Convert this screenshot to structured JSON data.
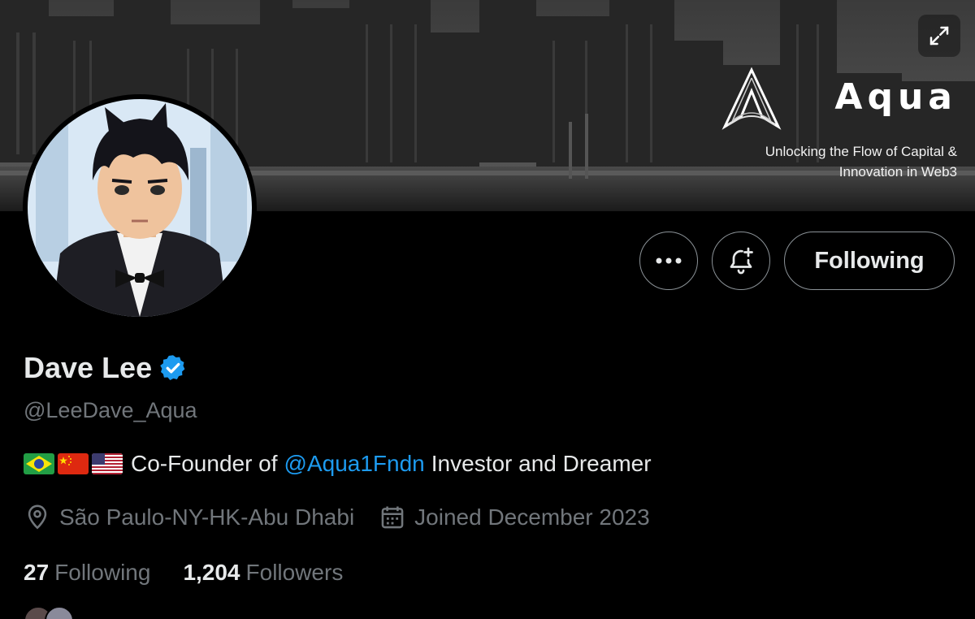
{
  "banner": {
    "brand_name": "Aqua",
    "brand_tagline_line1": "Unlocking the Flow of Capital &",
    "brand_tagline_line2": "Innovation in Web3",
    "expand_icon": "expand-icon"
  },
  "profile": {
    "display_name": "Dave Lee",
    "verified_icon": "verified-badge-icon",
    "handle": "@LeeDave_Aqua",
    "bio": {
      "flags": [
        "brazil-flag",
        "china-flag",
        "usa-flag"
      ],
      "prefix": "Co-Founder of",
      "mention": "@Aqua1Fndn",
      "suffix": "Investor and Dreamer"
    },
    "location": "São Paulo-NY-HK-Abu Dhabi",
    "joined": "Joined December 2023",
    "following_count": "27",
    "following_label": "Following",
    "followers_count": "1,204",
    "followers_label": "Followers"
  },
  "actions": {
    "more_icon": "more-icon",
    "notify_icon": "bell-plus-icon",
    "following_button": "Following"
  },
  "colors": {
    "background": "#000000",
    "text_primary": "#e7e9ea",
    "text_secondary": "#71767b",
    "accent": "#1d9bf0",
    "border": "#8b9297"
  }
}
